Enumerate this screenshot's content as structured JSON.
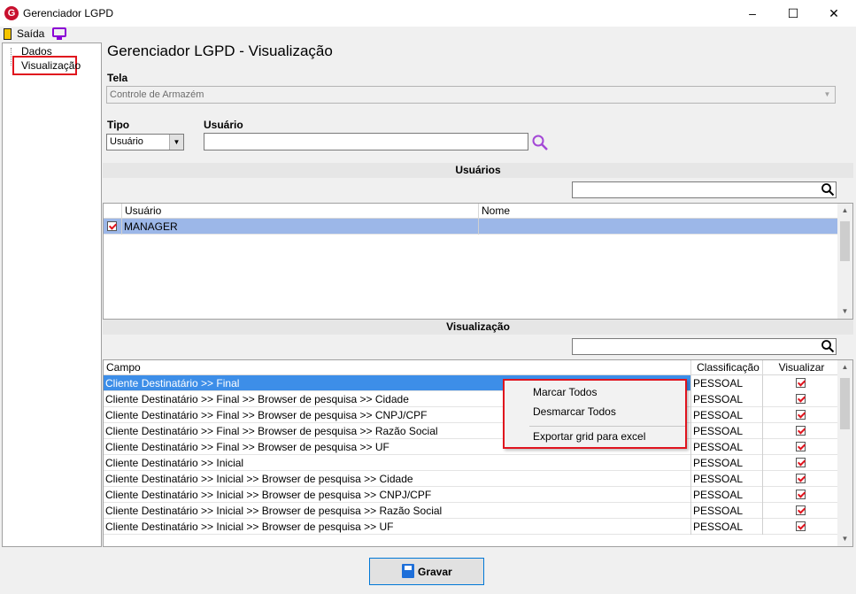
{
  "window": {
    "title": "Gerenciador LGPD",
    "logo_letter": "G",
    "minimize": "–",
    "maximize": "☐",
    "close": "✕"
  },
  "menubar": {
    "exit_label": "Saída"
  },
  "tree": {
    "items": [
      "Dados",
      "Visualização"
    ],
    "selected": "Visualização"
  },
  "main": {
    "title": "Gerenciador LGPD - Visualização",
    "tela_label": "Tela",
    "tela_value": "Controle de Armazém",
    "tipo_label": "Tipo",
    "tipo_value": "Usuário",
    "usuario_label": "Usuário",
    "usuario_value": ""
  },
  "usuarios_section": {
    "title": "Usuários",
    "filter_value": "",
    "columns": [
      "Usuário",
      "Nome"
    ],
    "rows": [
      {
        "checked": true,
        "usuario": "MANAGER",
        "nome": ""
      }
    ]
  },
  "visualizacao_section": {
    "title": "Visualização",
    "filter_value": "",
    "columns": [
      "Campo",
      "Classificação",
      "Visualizar"
    ],
    "rows": [
      {
        "campo": "Cliente Destinatário >> Final",
        "classificacao": "PESSOAL",
        "visualizar": true
      },
      {
        "campo": "Cliente Destinatário >> Final >> Browser de pesquisa >> Cidade",
        "classificacao": "PESSOAL",
        "visualizar": true
      },
      {
        "campo": "Cliente Destinatário >> Final >> Browser de pesquisa >> CNPJ/CPF",
        "classificacao": "PESSOAL",
        "visualizar": true
      },
      {
        "campo": "Cliente Destinatário >> Final >> Browser de pesquisa >> Razão Social",
        "classificacao": "PESSOAL",
        "visualizar": true
      },
      {
        "campo": "Cliente Destinatário >> Final >> Browser de pesquisa >> UF",
        "classificacao": "PESSOAL",
        "visualizar": true
      },
      {
        "campo": "Cliente Destinatário >> Inicial",
        "classificacao": "PESSOAL",
        "visualizar": true
      },
      {
        "campo": "Cliente Destinatário >> Inicial >> Browser de pesquisa >> Cidade",
        "classificacao": "PESSOAL",
        "visualizar": true
      },
      {
        "campo": "Cliente Destinatário >> Inicial >> Browser de pesquisa >> CNPJ/CPF",
        "classificacao": "PESSOAL",
        "visualizar": true
      },
      {
        "campo": "Cliente Destinatário >> Inicial >> Browser de pesquisa >> Razão Social",
        "classificacao": "PESSOAL",
        "visualizar": true
      },
      {
        "campo": "Cliente Destinatário >> Inicial >> Browser de pesquisa >> UF",
        "classificacao": "PESSOAL",
        "visualizar": true
      }
    ]
  },
  "context_menu": {
    "items": [
      "Marcar Todos",
      "Desmarcar Todos",
      "Exportar grid para excel"
    ]
  },
  "footer": {
    "save_label": "Gravar"
  },
  "colors": {
    "highlight": "#e0141e",
    "selection": "#3d8ee8",
    "accent": "#8b00d6"
  }
}
